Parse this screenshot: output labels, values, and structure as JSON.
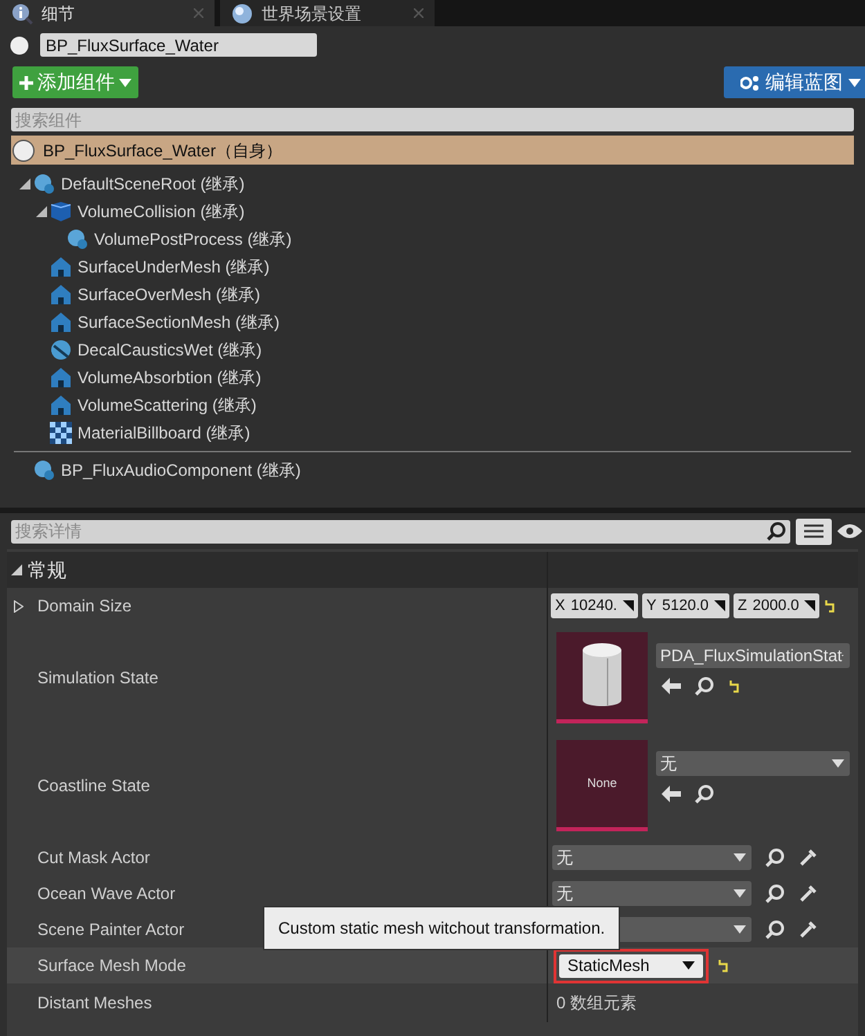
{
  "tabs": [
    {
      "label": "细节",
      "selected": true,
      "kind": "details"
    },
    {
      "label": "世界场景设置",
      "selected": false,
      "kind": "world"
    }
  ],
  "actor_name": "BP_FluxSurface_Water",
  "add_button": "添加组件",
  "blueprint_button": "编辑蓝图",
  "component_search": {
    "placeholder": "搜索组件"
  },
  "root_item": {
    "label": "BP_FluxSurface_Water（自身）",
    "selected": true
  },
  "tree": [
    {
      "label": "DefaultSceneRoot (继承)",
      "kind": "scene",
      "expanded": true,
      "children": [
        {
          "label": "VolumeCollision (继承)",
          "kind": "collision",
          "expanded": true,
          "children": [
            {
              "label": "VolumePostProcess (继承)",
              "kind": "scene"
            }
          ]
        },
        {
          "label": "SurfaceUnderMesh (继承)",
          "kind": "mesh"
        },
        {
          "label": "SurfaceOverMesh (继承)",
          "kind": "mesh"
        },
        {
          "label": "SurfaceSectionMesh (继承)",
          "kind": "mesh"
        },
        {
          "label": "DecalCausticsWet (继承)",
          "kind": "decal"
        },
        {
          "label": "VolumeAbsorbtion (继承)",
          "kind": "mesh"
        },
        {
          "label": "VolumeScattering (继承)",
          "kind": "mesh"
        },
        {
          "label": "MaterialBillboard (继承)",
          "kind": "billboard"
        }
      ]
    }
  ],
  "extra_items": [
    {
      "label": "BP_FluxAudioComponent (继承)",
      "kind": "scene"
    }
  ],
  "details_search": {
    "placeholder": "搜索详情"
  },
  "category": {
    "label": "常规",
    "expanded": true
  },
  "properties": [
    {
      "kind": "vector",
      "label": "Domain Size",
      "expanded": false,
      "fields": [
        {
          "axis": "X",
          "value": "10240."
        },
        {
          "axis": "Y",
          "value": "5120.0"
        },
        {
          "axis": "Z",
          "value": "2000.0"
        }
      ],
      "modified": true
    },
    {
      "kind": "asset",
      "label": "Simulation State",
      "preview": true,
      "value": "PDA_FluxSimulationStat",
      "modified": true
    },
    {
      "kind": "asset",
      "label": "Coastline State",
      "preview": false,
      "thumbnail_text": "None",
      "value": "无"
    },
    {
      "kind": "actor",
      "label": "Cut Mask Actor",
      "value": "无"
    },
    {
      "kind": "actor",
      "label": "Ocean Wave Actor",
      "value": "无"
    },
    {
      "kind": "actor",
      "label": "Scene Painter Actor"
    },
    {
      "kind": "enum",
      "label": "Surface Mesh Mode",
      "value": "StaticMesh",
      "hovered": true,
      "highlighted": true,
      "modified": true
    },
    {
      "kind": "array",
      "label": "Distant Meshes",
      "value": "0 数组元素"
    }
  ],
  "tooltip": "Custom static mesh witchout transformation."
}
